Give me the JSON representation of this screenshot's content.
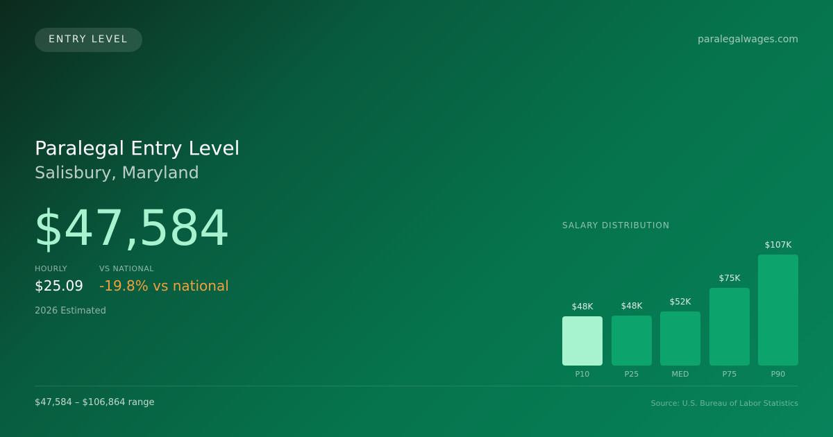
{
  "header": {
    "badge": "ENTRY LEVEL",
    "site": "paralegalwages.com"
  },
  "main": {
    "title": "Paralegal Entry Level",
    "subtitle": "Salisbury, Maryland",
    "salary": "$47,584",
    "hourly_label": "HOURLY",
    "hourly_value": "$25.09",
    "national_label": "VS NATIONAL",
    "national_value": "-19.8% vs national",
    "note": "2026 Estimated"
  },
  "distribution": {
    "title": "SALARY DISTRIBUTION"
  },
  "footer": {
    "range": "$47,584 – $106,864 range",
    "source": "Source: U.S. Bureau of Labor Statistics"
  },
  "colors": {
    "accent": "#a7f3d0",
    "bar": "#0da36d",
    "warning": "#f2a03d"
  },
  "chart_data": {
    "type": "bar",
    "categories": [
      "P10",
      "P25",
      "MED",
      "P75",
      "P90"
    ],
    "values": [
      47584,
      48000,
      52000,
      75000,
      106864
    ],
    "value_labels": [
      "$48K",
      "$48K",
      "$52K",
      "$75K",
      "$107K"
    ],
    "highlight_index": 0,
    "title": "SALARY DISTRIBUTION",
    "grid": false,
    "ylim": [
      0,
      106864
    ]
  }
}
